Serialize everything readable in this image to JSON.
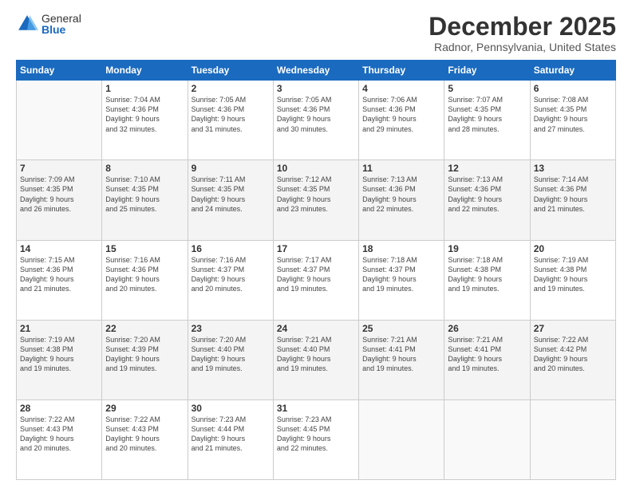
{
  "logo": {
    "general": "General",
    "blue": "Blue"
  },
  "title": "December 2025",
  "subtitle": "Radnor, Pennsylvania, United States",
  "days_header": [
    "Sunday",
    "Monday",
    "Tuesday",
    "Wednesday",
    "Thursday",
    "Friday",
    "Saturday"
  ],
  "weeks": [
    [
      {
        "num": "",
        "info": ""
      },
      {
        "num": "1",
        "info": "Sunrise: 7:04 AM\nSunset: 4:36 PM\nDaylight: 9 hours\nand 32 minutes."
      },
      {
        "num": "2",
        "info": "Sunrise: 7:05 AM\nSunset: 4:36 PM\nDaylight: 9 hours\nand 31 minutes."
      },
      {
        "num": "3",
        "info": "Sunrise: 7:05 AM\nSunset: 4:36 PM\nDaylight: 9 hours\nand 30 minutes."
      },
      {
        "num": "4",
        "info": "Sunrise: 7:06 AM\nSunset: 4:36 PM\nDaylight: 9 hours\nand 29 minutes."
      },
      {
        "num": "5",
        "info": "Sunrise: 7:07 AM\nSunset: 4:35 PM\nDaylight: 9 hours\nand 28 minutes."
      },
      {
        "num": "6",
        "info": "Sunrise: 7:08 AM\nSunset: 4:35 PM\nDaylight: 9 hours\nand 27 minutes."
      }
    ],
    [
      {
        "num": "7",
        "info": "Sunrise: 7:09 AM\nSunset: 4:35 PM\nDaylight: 9 hours\nand 26 minutes."
      },
      {
        "num": "8",
        "info": "Sunrise: 7:10 AM\nSunset: 4:35 PM\nDaylight: 9 hours\nand 25 minutes."
      },
      {
        "num": "9",
        "info": "Sunrise: 7:11 AM\nSunset: 4:35 PM\nDaylight: 9 hours\nand 24 minutes."
      },
      {
        "num": "10",
        "info": "Sunrise: 7:12 AM\nSunset: 4:35 PM\nDaylight: 9 hours\nand 23 minutes."
      },
      {
        "num": "11",
        "info": "Sunrise: 7:13 AM\nSunset: 4:36 PM\nDaylight: 9 hours\nand 22 minutes."
      },
      {
        "num": "12",
        "info": "Sunrise: 7:13 AM\nSunset: 4:36 PM\nDaylight: 9 hours\nand 22 minutes."
      },
      {
        "num": "13",
        "info": "Sunrise: 7:14 AM\nSunset: 4:36 PM\nDaylight: 9 hours\nand 21 minutes."
      }
    ],
    [
      {
        "num": "14",
        "info": "Sunrise: 7:15 AM\nSunset: 4:36 PM\nDaylight: 9 hours\nand 21 minutes."
      },
      {
        "num": "15",
        "info": "Sunrise: 7:16 AM\nSunset: 4:36 PM\nDaylight: 9 hours\nand 20 minutes."
      },
      {
        "num": "16",
        "info": "Sunrise: 7:16 AM\nSunset: 4:37 PM\nDaylight: 9 hours\nand 20 minutes."
      },
      {
        "num": "17",
        "info": "Sunrise: 7:17 AM\nSunset: 4:37 PM\nDaylight: 9 hours\nand 19 minutes."
      },
      {
        "num": "18",
        "info": "Sunrise: 7:18 AM\nSunset: 4:37 PM\nDaylight: 9 hours\nand 19 minutes."
      },
      {
        "num": "19",
        "info": "Sunrise: 7:18 AM\nSunset: 4:38 PM\nDaylight: 9 hours\nand 19 minutes."
      },
      {
        "num": "20",
        "info": "Sunrise: 7:19 AM\nSunset: 4:38 PM\nDaylight: 9 hours\nand 19 minutes."
      }
    ],
    [
      {
        "num": "21",
        "info": "Sunrise: 7:19 AM\nSunset: 4:38 PM\nDaylight: 9 hours\nand 19 minutes."
      },
      {
        "num": "22",
        "info": "Sunrise: 7:20 AM\nSunset: 4:39 PM\nDaylight: 9 hours\nand 19 minutes."
      },
      {
        "num": "23",
        "info": "Sunrise: 7:20 AM\nSunset: 4:40 PM\nDaylight: 9 hours\nand 19 minutes."
      },
      {
        "num": "24",
        "info": "Sunrise: 7:21 AM\nSunset: 4:40 PM\nDaylight: 9 hours\nand 19 minutes."
      },
      {
        "num": "25",
        "info": "Sunrise: 7:21 AM\nSunset: 4:41 PM\nDaylight: 9 hours\nand 19 minutes."
      },
      {
        "num": "26",
        "info": "Sunrise: 7:21 AM\nSunset: 4:41 PM\nDaylight: 9 hours\nand 19 minutes."
      },
      {
        "num": "27",
        "info": "Sunrise: 7:22 AM\nSunset: 4:42 PM\nDaylight: 9 hours\nand 20 minutes."
      }
    ],
    [
      {
        "num": "28",
        "info": "Sunrise: 7:22 AM\nSunset: 4:43 PM\nDaylight: 9 hours\nand 20 minutes."
      },
      {
        "num": "29",
        "info": "Sunrise: 7:22 AM\nSunset: 4:43 PM\nDaylight: 9 hours\nand 20 minutes."
      },
      {
        "num": "30",
        "info": "Sunrise: 7:23 AM\nSunset: 4:44 PM\nDaylight: 9 hours\nand 21 minutes."
      },
      {
        "num": "31",
        "info": "Sunrise: 7:23 AM\nSunset: 4:45 PM\nDaylight: 9 hours\nand 22 minutes."
      },
      {
        "num": "",
        "info": ""
      },
      {
        "num": "",
        "info": ""
      },
      {
        "num": "",
        "info": ""
      }
    ]
  ]
}
